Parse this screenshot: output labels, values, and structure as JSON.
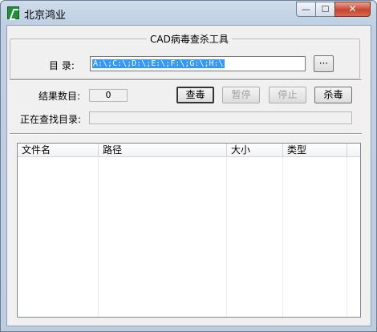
{
  "window": {
    "title": "北京鸿业",
    "minimize_glyph": "—",
    "maximize_glyph": "☐",
    "close_glyph": "✕"
  },
  "group": {
    "title": "CAD病毒查杀工具"
  },
  "directory": {
    "label": "目  录:",
    "value": "A:\\;C:\\;D:\\;E:\\;F:\\;G:\\;H:\\",
    "browse_label": "···"
  },
  "results": {
    "label": "结果数目:",
    "count": "0"
  },
  "buttons": {
    "scan": "查毒",
    "pause": "暂停",
    "stop": "停止",
    "kill": "杀毒"
  },
  "scanning": {
    "label": "正在查找目录:",
    "value": ""
  },
  "table": {
    "columns": [
      "文件名",
      "路径",
      "大小",
      "类型"
    ]
  }
}
